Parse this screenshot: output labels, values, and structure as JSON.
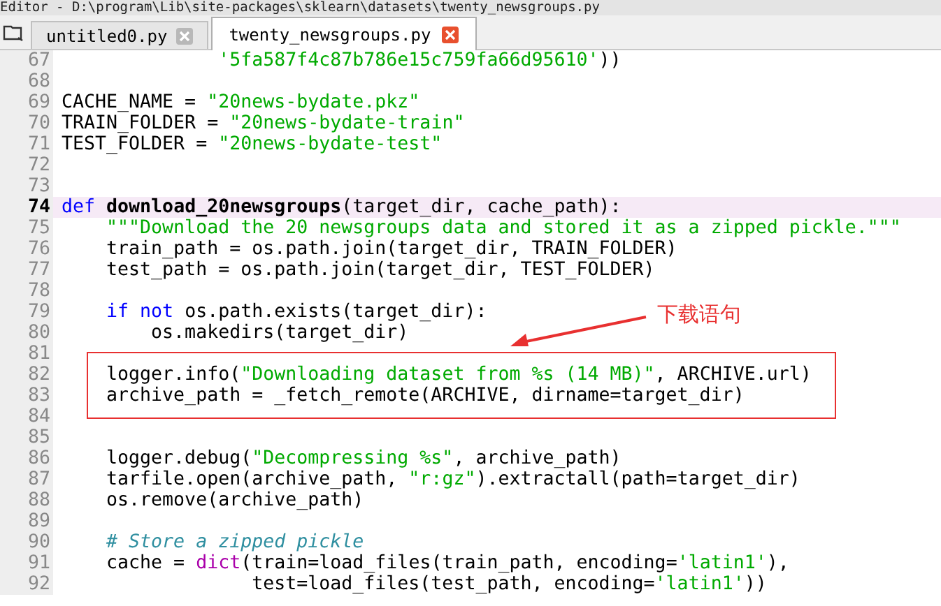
{
  "window": {
    "title": "Editor - D:\\program\\Lib\\site-packages\\sklearn\\datasets\\twenty_newsgroups.py"
  },
  "tabs": [
    {
      "label": "untitled0.py",
      "selected": false
    },
    {
      "label": "twenty_newsgroups.py",
      "selected": true
    }
  ],
  "editor": {
    "sections": [
      {
        "boxed": false,
        "lines": [
          {
            "number": "67",
            "current": false,
            "tokens": [
              {
                "kind": "string",
                "text": "              '5fa587f4c87b786e15c759fa66d95610'"
              },
              {
                "kind": "plain",
                "text": "))"
              }
            ]
          },
          {
            "number": "68",
            "current": false
          },
          {
            "number": "69",
            "current": false,
            "tokens": [
              {
                "kind": "plain",
                "text": "CACHE_NAME = "
              },
              {
                "kind": "string",
                "text": "\"20news-bydate.pkz\""
              }
            ]
          },
          {
            "number": "70",
            "current": false,
            "tokens": [
              {
                "kind": "plain",
                "text": "TRAIN_FOLDER = "
              },
              {
                "kind": "string",
                "text": "\"20news-bydate-train\""
              }
            ]
          },
          {
            "number": "71",
            "current": false,
            "tokens": [
              {
                "kind": "plain",
                "text": "TEST_FOLDER = "
              },
              {
                "kind": "string",
                "text": "\"20news-bydate-test\""
              }
            ]
          },
          {
            "number": "72",
            "current": false
          },
          {
            "number": "73",
            "current": false
          },
          {
            "number": "74",
            "current": true,
            "tokens": [
              {
                "kind": "keyword",
                "text": "def "
              },
              {
                "kind": "defname",
                "text": "download_20newsgroups"
              },
              {
                "kind": "plain",
                "text": "(target_dir, cache_path):"
              }
            ]
          },
          {
            "number": "75",
            "current": false,
            "tokens": [
              {
                "kind": "string",
                "text": "    \"\"\"Download the 20 newsgroups data and stored it as a zipped pickle.\"\"\""
              }
            ]
          },
          {
            "number": "76",
            "current": false,
            "tokens": [
              {
                "kind": "plain",
                "text": "    train_path = os.path.join(target_dir, TRAIN_FOLDER)"
              }
            ]
          },
          {
            "number": "77",
            "current": false,
            "tokens": [
              {
                "kind": "plain",
                "text": "    test_path = os.path.join(target_dir, TEST_FOLDER)"
              }
            ]
          },
          {
            "number": "78",
            "current": false
          },
          {
            "number": "79",
            "current": false,
            "tokens": [
              {
                "kind": "keyword",
                "text": "    if not "
              },
              {
                "kind": "plain",
                "text": "os.path.exists(target_dir):"
              }
            ]
          },
          {
            "number": "80",
            "current": false,
            "tokens": [
              {
                "kind": "plain",
                "text": "        os.makedirs(target_dir)"
              }
            ]
          }
        ]
      },
      {
        "boxed": true,
        "lines": [
          {
            "number": "81",
            "current": false
          },
          {
            "number": "82",
            "current": false,
            "tokens": [
              {
                "kind": "plain",
                "text": "    logger.info("
              },
              {
                "kind": "string",
                "text": "\"Downloading dataset from %s (14 MB)\""
              },
              {
                "kind": "plain",
                "text": ", ARCHIVE.url)"
              }
            ]
          },
          {
            "number": "83",
            "current": false,
            "tokens": [
              {
                "kind": "plain",
                "text": "    archive_path = _fetch_remote(ARCHIVE, dirname=target_dir)"
              }
            ]
          },
          {
            "number": "84",
            "current": false
          }
        ]
      },
      {
        "boxed": false,
        "lines": [
          {
            "number": "85",
            "current": false
          },
          {
            "number": "86",
            "current": false,
            "tokens": [
              {
                "kind": "plain",
                "text": "    logger.debug("
              },
              {
                "kind": "string",
                "text": "\"Decompressing %s\""
              },
              {
                "kind": "plain",
                "text": ", archive_path)"
              }
            ]
          },
          {
            "number": "87",
            "current": false,
            "tokens": [
              {
                "kind": "plain",
                "text": "    tarfile.open(archive_path, "
              },
              {
                "kind": "string",
                "text": "\"r:gz\""
              },
              {
                "kind": "plain",
                "text": ").extractall(path=target_dir)"
              }
            ]
          },
          {
            "number": "88",
            "current": false,
            "tokens": [
              {
                "kind": "plain",
                "text": "    os.remove(archive_path)"
              }
            ]
          },
          {
            "number": "89",
            "current": false
          },
          {
            "number": "90",
            "current": false,
            "tokens": [
              {
                "kind": "comment",
                "text": "    # Store a zipped pickle"
              }
            ]
          },
          {
            "number": "91",
            "current": false,
            "tokens": [
              {
                "kind": "plain",
                "text": "    cache = "
              },
              {
                "kind": "builtin",
                "text": "dict"
              },
              {
                "kind": "plain",
                "text": "(train=load_files(train_path, encoding="
              },
              {
                "kind": "string",
                "text": "'latin1'"
              },
              {
                "kind": "plain",
                "text": "),"
              }
            ]
          },
          {
            "number": "92",
            "current": false,
            "tokens": [
              {
                "kind": "plain",
                "text": "                 test=load_files(test_path, encoding="
              },
              {
                "kind": "string",
                "text": "'latin1'"
              },
              {
                "kind": "plain",
                "text": "))"
              }
            ]
          }
        ]
      }
    ]
  },
  "annotation": {
    "label": "下载语句"
  }
}
